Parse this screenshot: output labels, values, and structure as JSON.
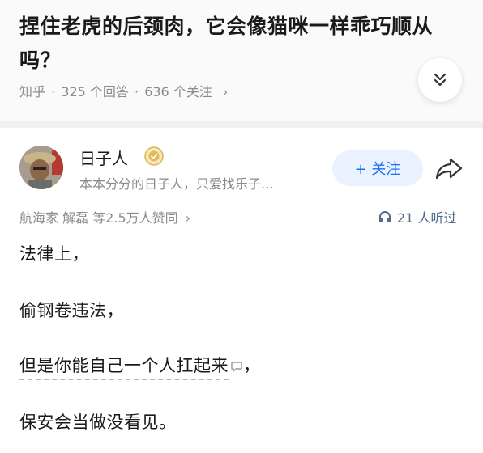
{
  "question": {
    "title": "捏住老虎的后颈肉，它会像猫咪一样乖巧顺从吗？",
    "source": "知乎",
    "answers": "325 个回答",
    "followers": "636 个关注",
    "sep": " · ",
    "arrow": "›"
  },
  "author": {
    "name": "日子人",
    "bio": "本本分分的日子人，只爱找乐子…",
    "follow_label": "+ 关注"
  },
  "stats": {
    "upvoters": "航海家 解磊 等2.5万人赞同",
    "upvoters_arrow": "›",
    "listens": "21 人听过"
  },
  "content": {
    "p1": "法律上，",
    "p2": "偷钢卷违法，",
    "p3_main": "但是你能自己一个人扛起来",
    "p3_tail": "，",
    "p4": "保安会当做没看见。"
  },
  "colors": {
    "accent": "#1772f6",
    "follow_bg": "#eaf1ff",
    "muted": "#8a8a8a"
  },
  "icons": [
    "chevron-double-down-icon",
    "verified-badge-icon",
    "share-icon",
    "headphones-icon",
    "comment-icon"
  ]
}
